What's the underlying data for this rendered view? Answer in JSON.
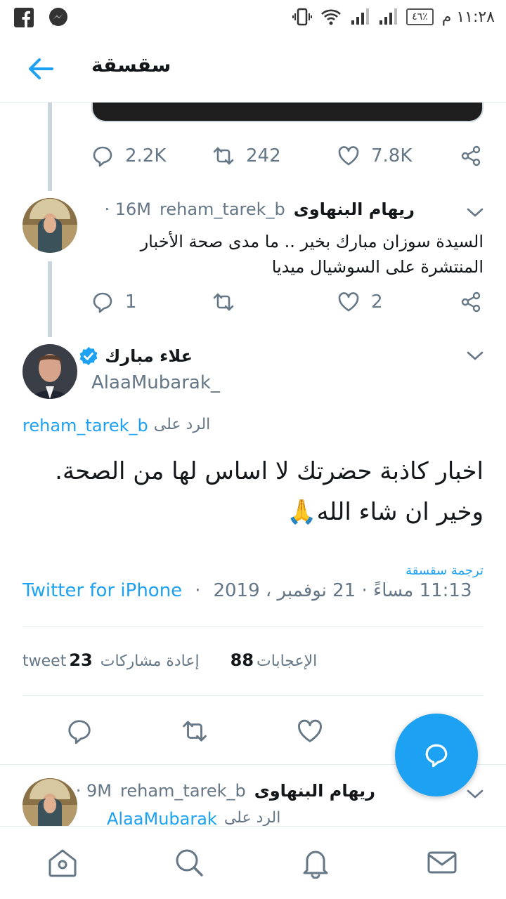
{
  "status_bar": {
    "time": "١١:٢٨ م",
    "battery": "٤٦٪"
  },
  "header": {
    "title": "سقسقة"
  },
  "prev_tweet_actions": {
    "replies": "2.2K",
    "retweets": "242",
    "likes": "7.8K"
  },
  "reply_tweet": {
    "name": "ريهام البنهاوى",
    "handle": "reham_tarek_b",
    "time": "· 16M",
    "text": "السيدة سوزان مبارك بخير .. ما مدى صحة الأخبار المنتشرة على السوشيال ميديا",
    "replies": "1",
    "retweets": "",
    "likes": "2"
  },
  "main_tweet": {
    "name": "علاء مبارك",
    "handle": "AlaaMubarak_",
    "replying_prefix": "الرد على",
    "replying_to": "reham_tarek_b",
    "text": "اخبار كاذبة حضرتك لا اساس لها من الصحة. وخير ان شاء الله🙏",
    "translate": "ترجمة سقسقة",
    "timestamp": "11:13 مساءً · 21 نوفمبر ، 2019",
    "dot": "·",
    "source": "Twitter for iPhone",
    "retweet_count": "23",
    "retweet_label": "إعادة مشاركات tweet",
    "like_count": "88",
    "like_label": "الإعجابات"
  },
  "next_tweet": {
    "name": "ريهام البنهاوى",
    "handle": "reham_tarek_b",
    "time": "· 9M",
    "replying_prefix": "الرد على",
    "replying_to": "AlaaMubarak_"
  },
  "colors": {
    "accent": "#1da1f2",
    "secondary_text": "#657786",
    "border": "#e6ecf0"
  }
}
